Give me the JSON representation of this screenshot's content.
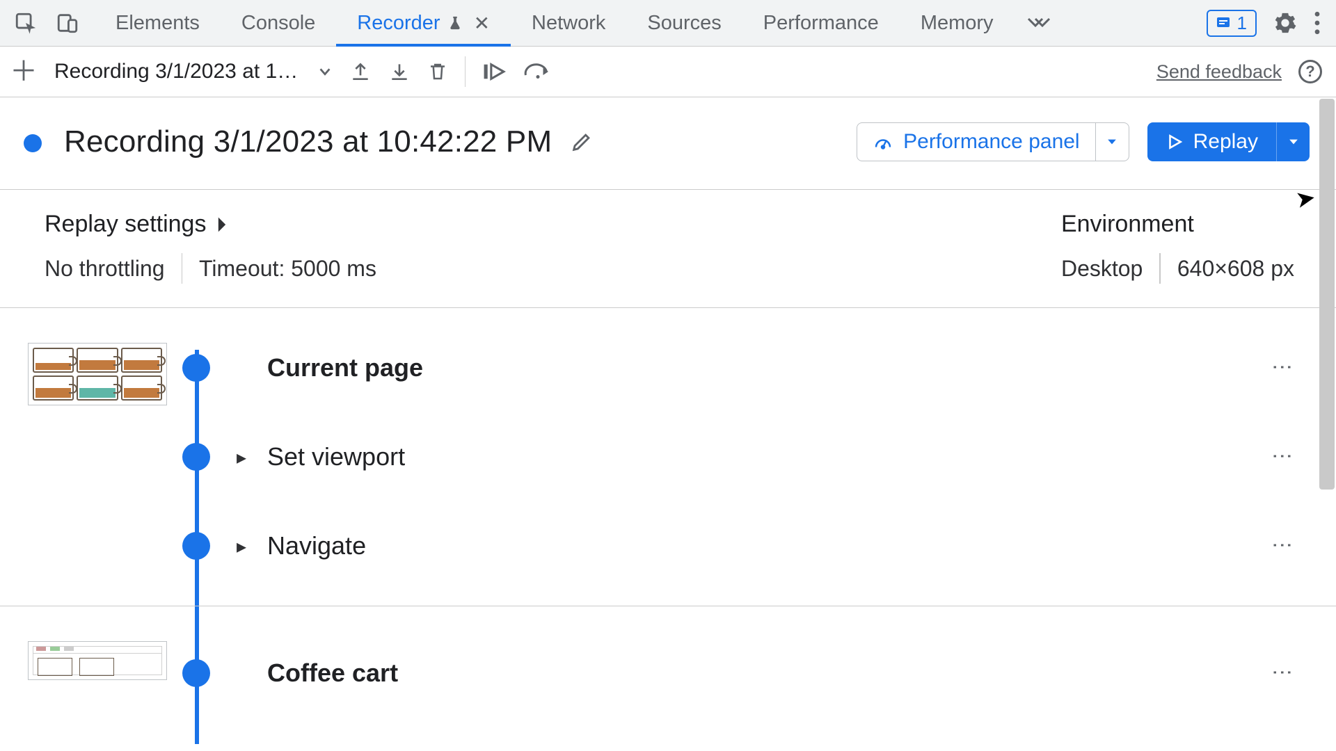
{
  "tabs": {
    "elements": "Elements",
    "console": "Console",
    "recorder": "Recorder",
    "network": "Network",
    "sources": "Sources",
    "performance": "Performance",
    "memory": "Memory"
  },
  "issues_badge": {
    "count": "1"
  },
  "toolbar": {
    "recording_select": "Recording 3/1/2023 at 10…",
    "send_feedback": "Send feedback"
  },
  "header": {
    "title": "Recording 3/1/2023 at 10:42:22 PM",
    "perf_panel": "Performance panel",
    "replay": "Replay"
  },
  "replay_settings": {
    "heading": "Replay settings",
    "throttling": "No throttling",
    "timeout": "Timeout: 5000 ms"
  },
  "environment": {
    "heading": "Environment",
    "device": "Desktop",
    "viewport": "640×608 px"
  },
  "steps": {
    "section1": {
      "s1": "Current page",
      "s2": "Set viewport",
      "s3": "Navigate"
    },
    "section2": {
      "s1": "Coffee cart"
    }
  }
}
